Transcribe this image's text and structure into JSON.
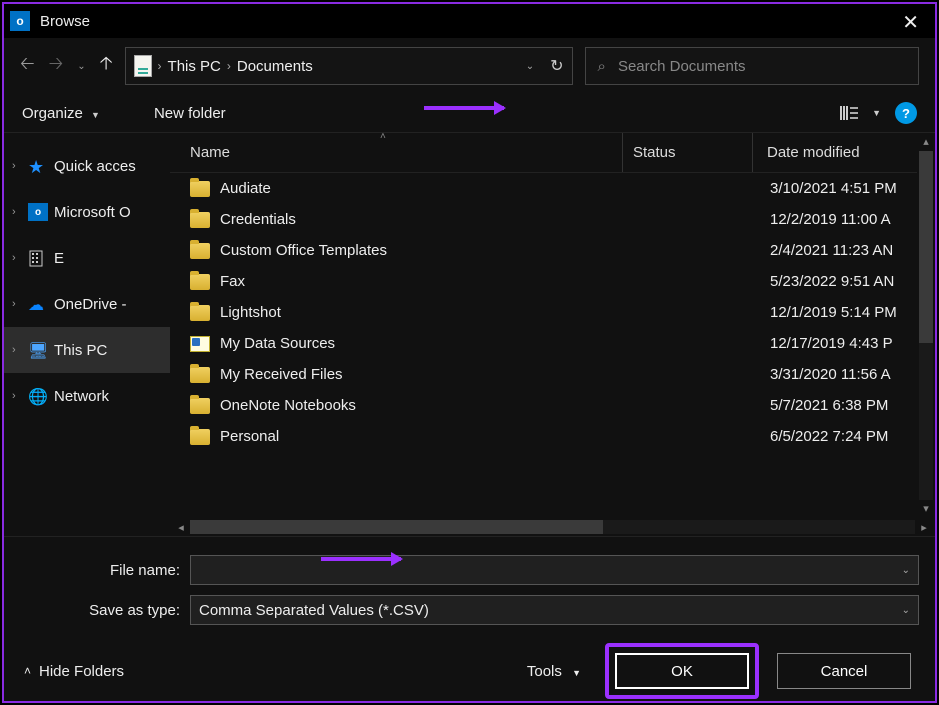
{
  "window": {
    "title": "Browse"
  },
  "breadcrumb": {
    "loc1": "This PC",
    "loc2": "Documents"
  },
  "search": {
    "placeholder": "Search Documents"
  },
  "toolbar": {
    "organize": "Organize",
    "newfolder": "New folder"
  },
  "columns": {
    "name": "Name",
    "status": "Status",
    "date": "Date modified"
  },
  "tree": {
    "items": [
      {
        "label": "Quick acces",
        "kind": "star"
      },
      {
        "label": "Microsoft O",
        "kind": "outlook"
      },
      {
        "label": "E",
        "kind": "building"
      },
      {
        "label": "OneDrive - ",
        "kind": "cloud"
      },
      {
        "label": "This PC",
        "kind": "pc",
        "selected": true
      },
      {
        "label": "Network",
        "kind": "network"
      }
    ]
  },
  "files": [
    {
      "name": "Audiate",
      "date": "3/10/2021 4:51 PM",
      "kind": "folder"
    },
    {
      "name": "Credentials",
      "date": "12/2/2019 11:00 A",
      "kind": "folder"
    },
    {
      "name": "Custom Office Templates",
      "date": "2/4/2021 11:23 AN",
      "kind": "folder"
    },
    {
      "name": "Fax",
      "date": "5/23/2022 9:51 AN",
      "kind": "folder"
    },
    {
      "name": "Lightshot",
      "date": "12/1/2019 5:14 PM",
      "kind": "folder"
    },
    {
      "name": "My Data Sources",
      "date": "12/17/2019 4:43 P",
      "kind": "datasource"
    },
    {
      "name": "My Received Files",
      "date": "3/31/2020 11:56 A",
      "kind": "folder"
    },
    {
      "name": "OneNote Notebooks",
      "date": "5/7/2021 6:38 PM",
      "kind": "folder"
    },
    {
      "name": "Personal",
      "date": "6/5/2022 7:24 PM",
      "kind": "folder"
    }
  ],
  "form": {
    "filename_label": "File name:",
    "filename_value": "",
    "savetype_label": "Save as type:",
    "savetype_value": "Comma Separated Values (*.CSV)"
  },
  "footer": {
    "hide": "Hide Folders",
    "tools": "Tools",
    "ok": "OK",
    "cancel": "Cancel"
  }
}
